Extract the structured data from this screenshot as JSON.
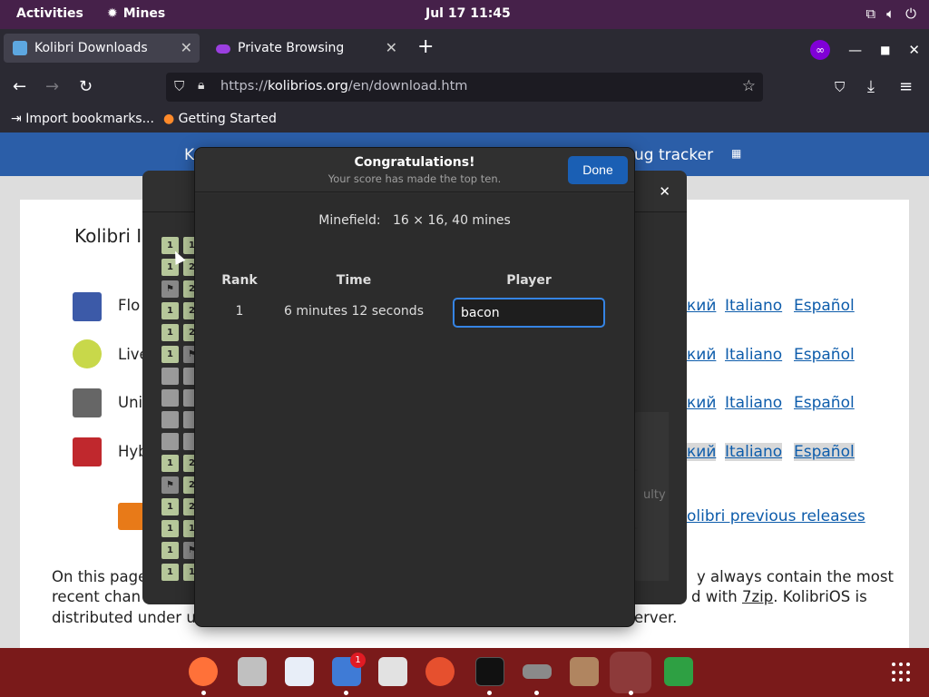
{
  "topbar": {
    "activities": "Activities",
    "app_name": "Mines",
    "clock": "Jul 17  11:45"
  },
  "browser": {
    "tabs": [
      {
        "label": "Kolibri Downloads"
      },
      {
        "label": "Private Browsing"
      }
    ],
    "url_prefix": "https://",
    "url_domain": "kolibrios.org",
    "url_path": "/en/download.htm",
    "bookmarks": [
      {
        "label": "Import bookmarks..."
      },
      {
        "label": "Getting Started"
      }
    ]
  },
  "page": {
    "banner_left": "Ko",
    "banner_right": "ug tracker",
    "heading": "Kolibri I",
    "rows": [
      {
        "label": "Flo",
        "lang1": "кий",
        "lang2": "Italiano",
        "lang3": "Español"
      },
      {
        "label": "Live",
        "lang1": "кий",
        "lang2": "Italiano",
        "lang3": "Español"
      },
      {
        "label": "Uni",
        "lang1": "кий",
        "lang2": "Italiano",
        "lang3": "Español"
      },
      {
        "label": "Hyb",
        "lang1": "кий",
        "lang2": "Italiano",
        "lang3": "Español"
      }
    ],
    "previous_releases": "olibri previous releases",
    "faded_text": "ulty",
    "para_left1": "On this page",
    "para_left2": "recent chan",
    "para_left3": "distributed under u",
    "para_right1": "y always contain the most",
    "para_right2": "d with",
    "para_right2_link": "7zip",
    "para_right2_end": ". KolibriOS is",
    "para_right3": "erver."
  },
  "mines": {
    "left_cells": [
      "1",
      "1",
      "F",
      "1",
      "1",
      "1",
      "",
      "",
      "",
      "",
      "1",
      "F",
      "1",
      "1",
      "1",
      "1"
    ],
    "right_cells": [
      "1",
      "2",
      "2",
      "2",
      "2",
      "F",
      "",
      "",
      "",
      "",
      "2",
      "2",
      "2",
      "1",
      "F",
      "1"
    ]
  },
  "dialog": {
    "title": "Congratulations!",
    "subtitle": "Your score has made the top ten.",
    "done_label": "Done",
    "minefield_label": "Minefield:",
    "minefield_value": "16 × 16, 40 mines",
    "col_rank": "Rank",
    "col_time": "Time",
    "col_player": "Player",
    "entry": {
      "rank": "1",
      "time": "6 minutes 12 seconds",
      "player": "bacon"
    }
  },
  "dock": {
    "notification_count": "1"
  }
}
